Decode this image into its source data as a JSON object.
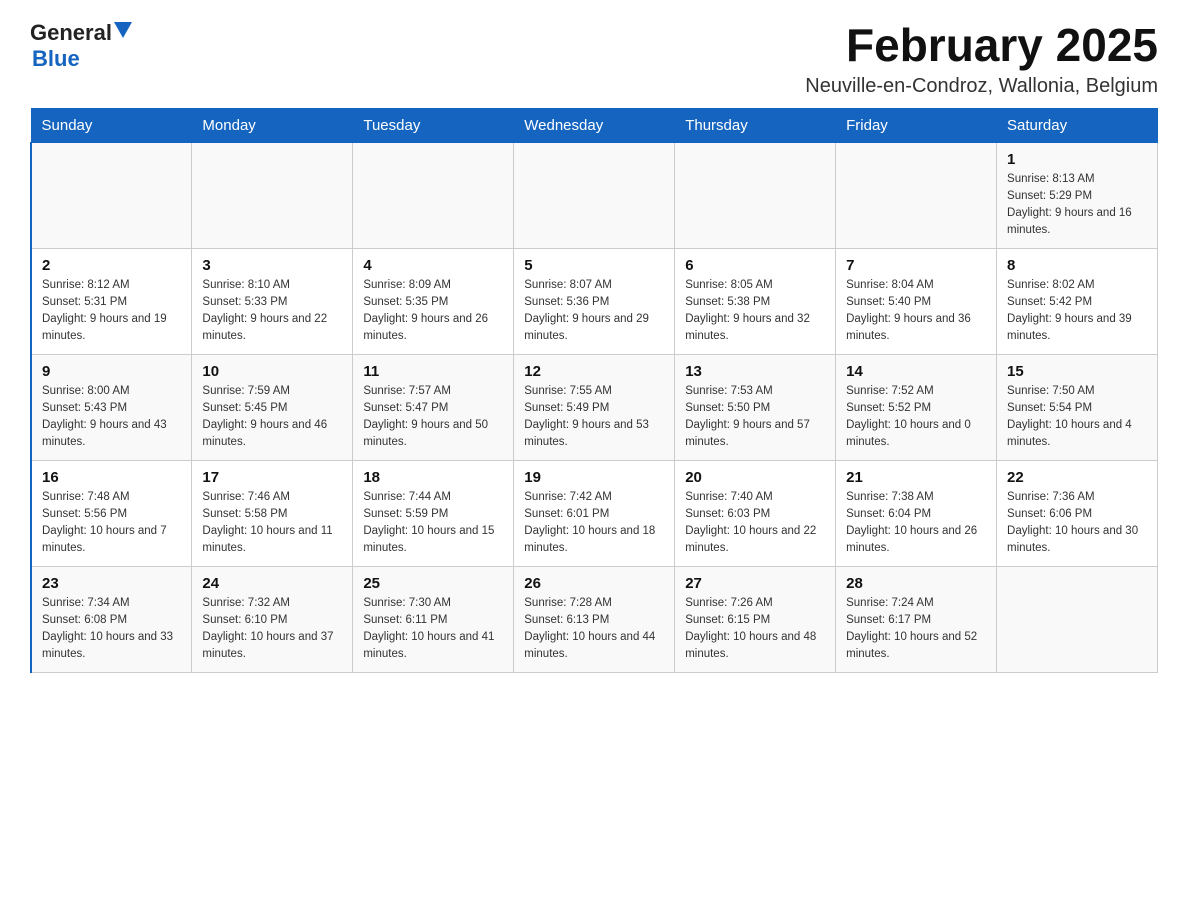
{
  "header": {
    "logo": {
      "general": "General",
      "blue": "Blue"
    },
    "title": "February 2025",
    "location": "Neuville-en-Condroz, Wallonia, Belgium"
  },
  "days_of_week": [
    "Sunday",
    "Monday",
    "Tuesday",
    "Wednesday",
    "Thursday",
    "Friday",
    "Saturday"
  ],
  "weeks": [
    [
      {
        "day": "",
        "info": ""
      },
      {
        "day": "",
        "info": ""
      },
      {
        "day": "",
        "info": ""
      },
      {
        "day": "",
        "info": ""
      },
      {
        "day": "",
        "info": ""
      },
      {
        "day": "",
        "info": ""
      },
      {
        "day": "1",
        "info": "Sunrise: 8:13 AM\nSunset: 5:29 PM\nDaylight: 9 hours and 16 minutes."
      }
    ],
    [
      {
        "day": "2",
        "info": "Sunrise: 8:12 AM\nSunset: 5:31 PM\nDaylight: 9 hours and 19 minutes."
      },
      {
        "day": "3",
        "info": "Sunrise: 8:10 AM\nSunset: 5:33 PM\nDaylight: 9 hours and 22 minutes."
      },
      {
        "day": "4",
        "info": "Sunrise: 8:09 AM\nSunset: 5:35 PM\nDaylight: 9 hours and 26 minutes."
      },
      {
        "day": "5",
        "info": "Sunrise: 8:07 AM\nSunset: 5:36 PM\nDaylight: 9 hours and 29 minutes."
      },
      {
        "day": "6",
        "info": "Sunrise: 8:05 AM\nSunset: 5:38 PM\nDaylight: 9 hours and 32 minutes."
      },
      {
        "day": "7",
        "info": "Sunrise: 8:04 AM\nSunset: 5:40 PM\nDaylight: 9 hours and 36 minutes."
      },
      {
        "day": "8",
        "info": "Sunrise: 8:02 AM\nSunset: 5:42 PM\nDaylight: 9 hours and 39 minutes."
      }
    ],
    [
      {
        "day": "9",
        "info": "Sunrise: 8:00 AM\nSunset: 5:43 PM\nDaylight: 9 hours and 43 minutes."
      },
      {
        "day": "10",
        "info": "Sunrise: 7:59 AM\nSunset: 5:45 PM\nDaylight: 9 hours and 46 minutes."
      },
      {
        "day": "11",
        "info": "Sunrise: 7:57 AM\nSunset: 5:47 PM\nDaylight: 9 hours and 50 minutes."
      },
      {
        "day": "12",
        "info": "Sunrise: 7:55 AM\nSunset: 5:49 PM\nDaylight: 9 hours and 53 minutes."
      },
      {
        "day": "13",
        "info": "Sunrise: 7:53 AM\nSunset: 5:50 PM\nDaylight: 9 hours and 57 minutes."
      },
      {
        "day": "14",
        "info": "Sunrise: 7:52 AM\nSunset: 5:52 PM\nDaylight: 10 hours and 0 minutes."
      },
      {
        "day": "15",
        "info": "Sunrise: 7:50 AM\nSunset: 5:54 PM\nDaylight: 10 hours and 4 minutes."
      }
    ],
    [
      {
        "day": "16",
        "info": "Sunrise: 7:48 AM\nSunset: 5:56 PM\nDaylight: 10 hours and 7 minutes."
      },
      {
        "day": "17",
        "info": "Sunrise: 7:46 AM\nSunset: 5:58 PM\nDaylight: 10 hours and 11 minutes."
      },
      {
        "day": "18",
        "info": "Sunrise: 7:44 AM\nSunset: 5:59 PM\nDaylight: 10 hours and 15 minutes."
      },
      {
        "day": "19",
        "info": "Sunrise: 7:42 AM\nSunset: 6:01 PM\nDaylight: 10 hours and 18 minutes."
      },
      {
        "day": "20",
        "info": "Sunrise: 7:40 AM\nSunset: 6:03 PM\nDaylight: 10 hours and 22 minutes."
      },
      {
        "day": "21",
        "info": "Sunrise: 7:38 AM\nSunset: 6:04 PM\nDaylight: 10 hours and 26 minutes."
      },
      {
        "day": "22",
        "info": "Sunrise: 7:36 AM\nSunset: 6:06 PM\nDaylight: 10 hours and 30 minutes."
      }
    ],
    [
      {
        "day": "23",
        "info": "Sunrise: 7:34 AM\nSunset: 6:08 PM\nDaylight: 10 hours and 33 minutes."
      },
      {
        "day": "24",
        "info": "Sunrise: 7:32 AM\nSunset: 6:10 PM\nDaylight: 10 hours and 37 minutes."
      },
      {
        "day": "25",
        "info": "Sunrise: 7:30 AM\nSunset: 6:11 PM\nDaylight: 10 hours and 41 minutes."
      },
      {
        "day": "26",
        "info": "Sunrise: 7:28 AM\nSunset: 6:13 PM\nDaylight: 10 hours and 44 minutes."
      },
      {
        "day": "27",
        "info": "Sunrise: 7:26 AM\nSunset: 6:15 PM\nDaylight: 10 hours and 48 minutes."
      },
      {
        "day": "28",
        "info": "Sunrise: 7:24 AM\nSunset: 6:17 PM\nDaylight: 10 hours and 52 minutes."
      },
      {
        "day": "",
        "info": ""
      }
    ]
  ]
}
